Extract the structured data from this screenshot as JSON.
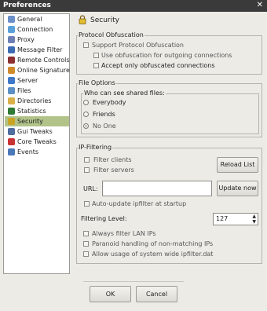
{
  "window": {
    "title": "Preferences",
    "close_glyph": "✕"
  },
  "sidebar": {
    "items": [
      {
        "label": "General",
        "icon": "wrench-icon",
        "color": "#6a8fc7"
      },
      {
        "label": "Connection",
        "icon": "plug-icon",
        "color": "#5aa0d8"
      },
      {
        "label": "Proxy",
        "icon": "proxy-icon",
        "color": "#6c7fb5"
      },
      {
        "label": "Message Filter",
        "icon": "filter-icon",
        "color": "#3b6bb2"
      },
      {
        "label": "Remote Controls",
        "icon": "remote-icon",
        "color": "#8c3030"
      },
      {
        "label": "Online Signature",
        "icon": "signature-icon",
        "color": "#d08a2a"
      },
      {
        "label": "Server",
        "icon": "server-icon",
        "color": "#3f78c8"
      },
      {
        "label": "Files",
        "icon": "files-icon",
        "color": "#5c8fc3"
      },
      {
        "label": "Directories",
        "icon": "folder-icon",
        "color": "#d9b04a"
      },
      {
        "label": "Statistics",
        "icon": "statistics-icon",
        "color": "#2f7a35"
      },
      {
        "label": "Security",
        "icon": "lock-icon",
        "color": "#c9a423"
      },
      {
        "label": "Gui Tweaks",
        "icon": "gui-tweaks-icon",
        "color": "#4f6d9e"
      },
      {
        "label": "Core Tweaks",
        "icon": "core-tweaks-icon",
        "color": "#c83232"
      },
      {
        "label": "Events",
        "icon": "events-icon",
        "color": "#4a78b8"
      }
    ],
    "selected": "Security"
  },
  "header": {
    "title": "Security"
  },
  "protocol_obfuscation": {
    "title": "Protocol Obfuscation",
    "support": "Support Protocol Obfuscation",
    "outgoing": "Use obfuscation for outgoing connections",
    "accept_only": "Accept only obfuscated connections"
  },
  "file_options": {
    "title": "File Options",
    "shared_title": "Who can see shared files:",
    "everybody": "Everybody",
    "friends": "Friends",
    "no_one": "No One"
  },
  "ip_filtering": {
    "title": "IP-Filtering",
    "filter_clients": "Filter clients",
    "filter_servers": "Filter servers",
    "reload_list": "Reload List",
    "url_label": "URL:",
    "url_value": "",
    "update_now": "Update now",
    "auto_update": "Auto-update ipfilter at startup",
    "level_label": "Filtering Level:",
    "level_value": "127",
    "always_lan": "Always filter LAN IPs",
    "paranoid": "Paranoid handling of non-matching IPs",
    "system_wide": "Allow usage of system wide ipfilter.dat"
  },
  "footer": {
    "ok": "OK",
    "cancel": "Cancel"
  }
}
